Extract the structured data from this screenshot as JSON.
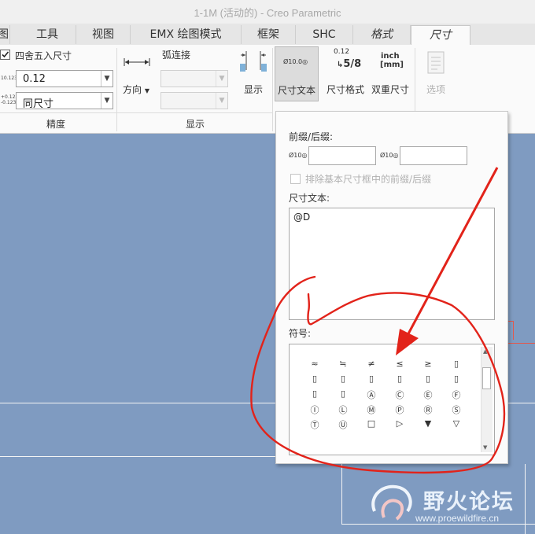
{
  "window": {
    "title": "1-1M (活动的) - Creo Parametric"
  },
  "tabs": [
    {
      "label": "图"
    },
    {
      "label": "工具"
    },
    {
      "label": "视图"
    },
    {
      "label": "EMX 绘图模式"
    },
    {
      "label": "框架"
    },
    {
      "label": "SHC"
    },
    {
      "label": "格式"
    },
    {
      "label": "尺寸"
    }
  ],
  "ribbon": {
    "precision": {
      "round_label": "四舍五入尺寸",
      "round_checked": true,
      "value": "0.12",
      "tolerance": "同尺寸",
      "group_label": "精度",
      "value_icon": "10.123",
      "tol_icon_top": "+0.123",
      "tol_icon_bottom": "-0.123"
    },
    "direction_label": "方向",
    "arc_label": "弧连接",
    "display_label": "显示",
    "display_group_label": "显示",
    "dim_text_label": "尺寸文本",
    "dim_text_icon": "Ø10.0",
    "dim_format_label": "尺寸格式",
    "dim_format_icon_top": "0.12",
    "dim_format_icon_bottom": "5/8",
    "dual_dim_label": "双重尺寸",
    "dual_dim_icon_top": "inch",
    "dual_dim_icon_bottom": "[mm]",
    "options_label": "选项"
  },
  "panel": {
    "prefix_suffix_label": "前缀/后缀:",
    "prefix_icon": "Ø10",
    "suffix_icon": "Ø10",
    "prefix_value": "",
    "suffix_value": "",
    "exclude_label": "排除基本尺寸框中的前缀/后缀",
    "dim_text_label": "尺寸文本:",
    "dim_text_value": "@D",
    "symbols_label": "符号:",
    "symbols": [
      [
        "≈",
        "≒",
        "≠",
        "≤",
        "≥",
        "▯"
      ],
      [
        "▯",
        "▯",
        "▯",
        "▯",
        "▯",
        "▯"
      ],
      [
        "▯",
        "▯",
        "Ⓐ",
        "Ⓒ",
        "Ⓔ",
        "Ⓕ"
      ],
      [
        "Ⓘ",
        "Ⓛ",
        "Ⓜ",
        "Ⓟ",
        "Ⓡ",
        "Ⓢ"
      ],
      [
        "Ⓣ",
        "Ⓤ",
        "□",
        "▷",
        "▼",
        "▽"
      ]
    ]
  },
  "watermark": {
    "name": "野火论坛",
    "url": "www.proewildfire.cn"
  },
  "colors": {
    "canvas": "#7f9bc1",
    "annotation": "#e2231a",
    "panel": "#fbfbfb"
  }
}
